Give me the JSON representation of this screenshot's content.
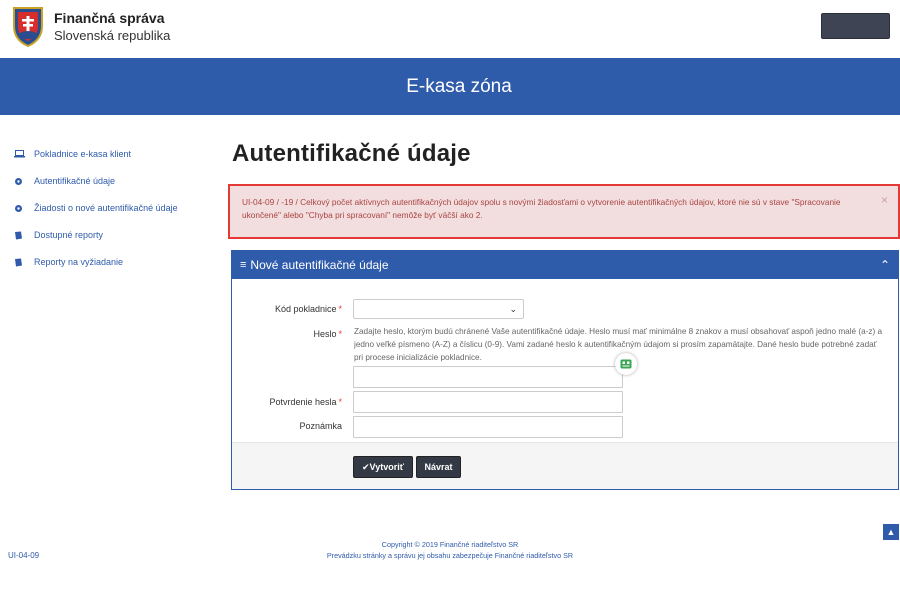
{
  "header": {
    "brand_title": "Finančná správa",
    "brand_subtitle": "Slovenská republika",
    "login_button_label": ""
  },
  "banner": {
    "title": "E-kasa zóna"
  },
  "sidebar": {
    "items": [
      {
        "label": "Pokladnice e-kasa klient",
        "icon": "laptop-icon"
      },
      {
        "label": "Autentifikačné údaje",
        "icon": "gear-icon"
      },
      {
        "label": "Žiadosti o nové autentifikačné údaje",
        "icon": "gear-icon"
      },
      {
        "label": "Dostupné reporty",
        "icon": "book-icon"
      },
      {
        "label": "Reporty na vyžiadanie",
        "icon": "book-icon"
      }
    ]
  },
  "main": {
    "page_title": "Autentifikačné údaje",
    "alert": {
      "text": "UI-04-09 / -19 / Celkový počet aktívnych autentifikačných údajov spolu s novými žiadosťami o vytvorenie autentifikačných údajov, ktoré nie sú v stave \"Spracovanie ukončené\" alebo \"Chyba pri spracovaní\" nemôže byť väčší ako 2.",
      "close": "×"
    },
    "panel": {
      "title": "Nové autentifikačné údaje",
      "form": {
        "kod_pokladnice_label": "Kód pokladnice",
        "kod_pokladnice_value": "",
        "heslo_label": "Heslo",
        "heslo_help": "Zadajte heslo, ktorým budú chránené Vaše autentifikačné údaje. Heslo musí mať minimálne 8 znakov a musí obsahovať aspoň jedno malé (a-z) a jedno veľké písmeno (A-Z) a číslicu (0-9). Vami zadané heslo k autentifikačným údajom si prosím zapamätajte. Dané heslo bude potrebné zadať pri procese inicializácie pokladnice.",
        "heslo_value": "",
        "potvrdenie_label": "Potvrdenie hesla",
        "potvrdenie_value": "",
        "poznamka_label": "Poznámka",
        "poznamka_value": "",
        "required_mark": "*"
      },
      "buttons": {
        "create": "✔Vytvoriť",
        "back": "Návrat"
      }
    }
  },
  "footer": {
    "id": "UI-04-09",
    "copyright": "Copyright © 2019 Finančné riaditeľstvo SR",
    "operator": "Prevádzku stránky a správu jej obsahu zabezpečuje Finančné riaditeľstvo SR"
  },
  "colors": {
    "primary": "#2f5bab",
    "alert_bg": "#f2dede",
    "alert_border": "#e53935",
    "alert_text": "#a94442",
    "button_dark": "#333a45"
  }
}
